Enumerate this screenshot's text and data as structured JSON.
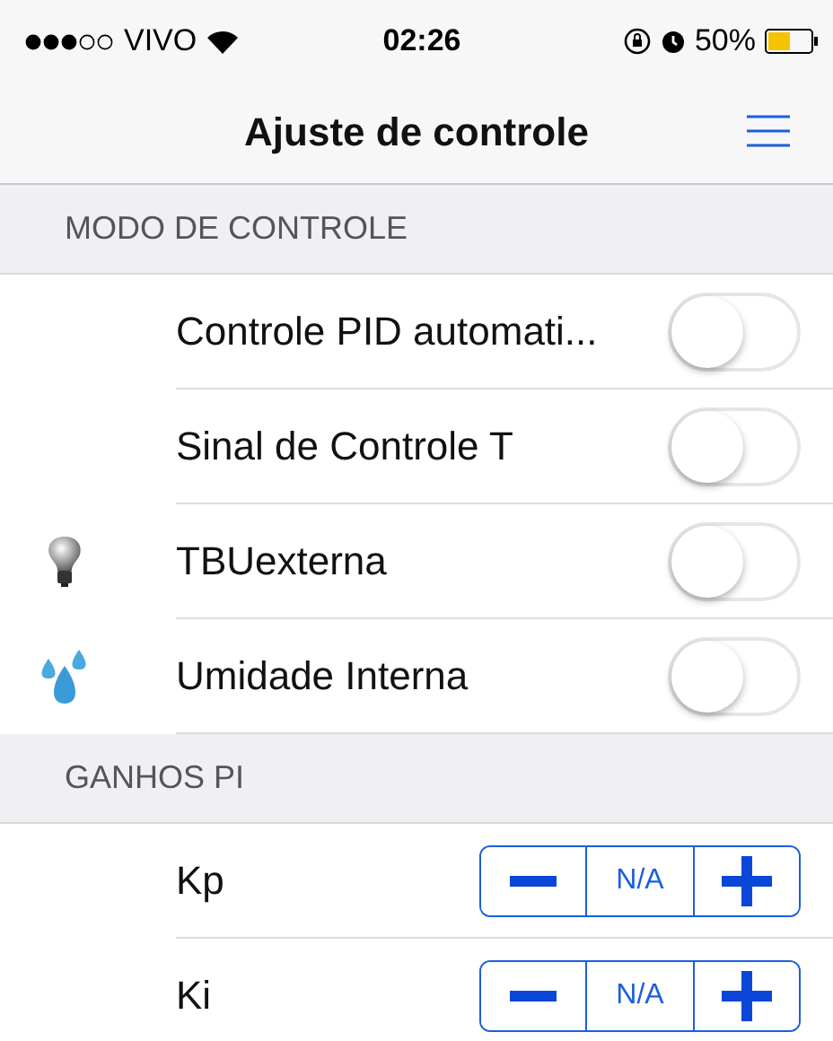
{
  "status_bar": {
    "carrier": "VIVO",
    "time": "02:26",
    "battery": "50%"
  },
  "nav": {
    "title": "Ajuste de controle"
  },
  "sections": [
    {
      "header": "MODO DE CONTROLE",
      "rows": [
        {
          "kind": "switch",
          "label": "Controle PID automati...",
          "on": false
        },
        {
          "kind": "switch",
          "label": "Sinal de Controle T",
          "on": false
        },
        {
          "kind": "switch",
          "label": "TBUexterna",
          "on": false
        },
        {
          "kind": "switch",
          "label": "Umidade Interna",
          "on": false
        }
      ]
    },
    {
      "header": "GANHOS PI",
      "rows": [
        {
          "kind": "stepper",
          "label": "Kp",
          "value": "N/A"
        },
        {
          "kind": "stepper",
          "label": "Ki",
          "value": "N/A"
        }
      ]
    }
  ]
}
